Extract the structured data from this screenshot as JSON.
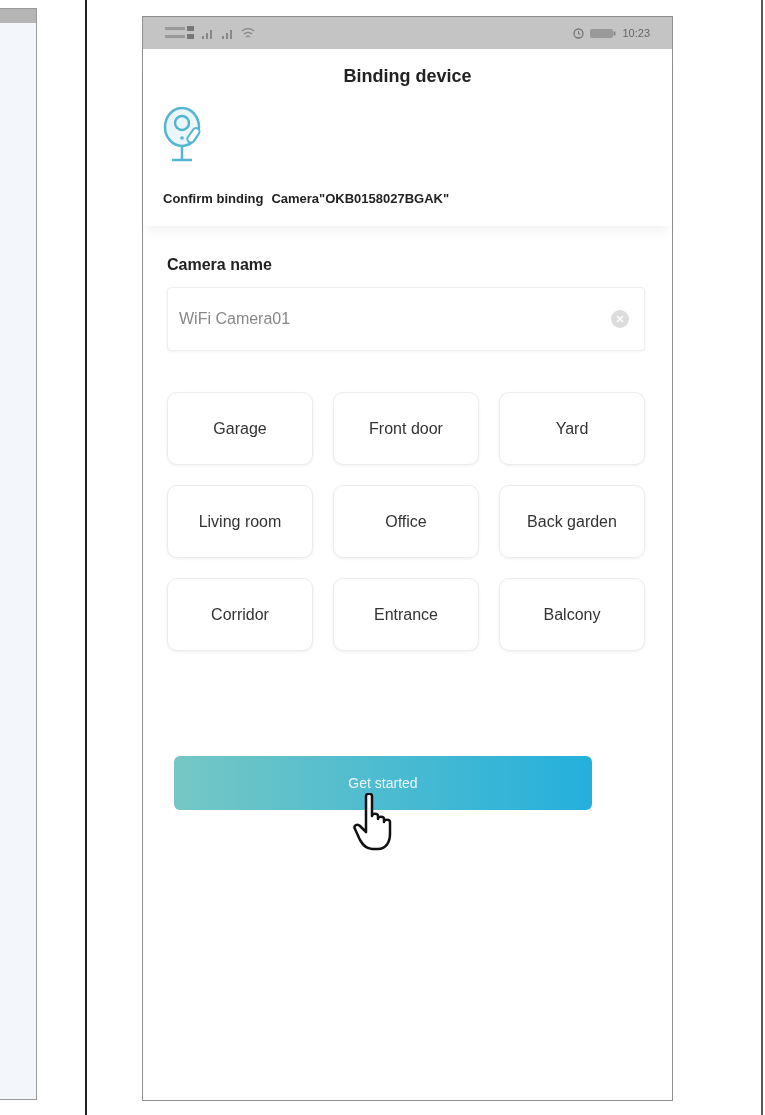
{
  "status_bar": {
    "time": "10:23"
  },
  "title": "Binding device",
  "confirm": {
    "label": "Confirm binding",
    "device": "Camera\"OKB0158027BGAK\""
  },
  "name_section": {
    "label": "Camera name",
    "value": "WiFi Camera01"
  },
  "tags": [
    {
      "label": "Garage"
    },
    {
      "label": "Front door"
    },
    {
      "label": "Yard"
    },
    {
      "label": "Living room"
    },
    {
      "label": "Office"
    },
    {
      "label": "Back garden"
    },
    {
      "label": "Corridor"
    },
    {
      "label": "Entrance"
    },
    {
      "label": "Balcony"
    }
  ],
  "button": {
    "label": "Get started"
  }
}
